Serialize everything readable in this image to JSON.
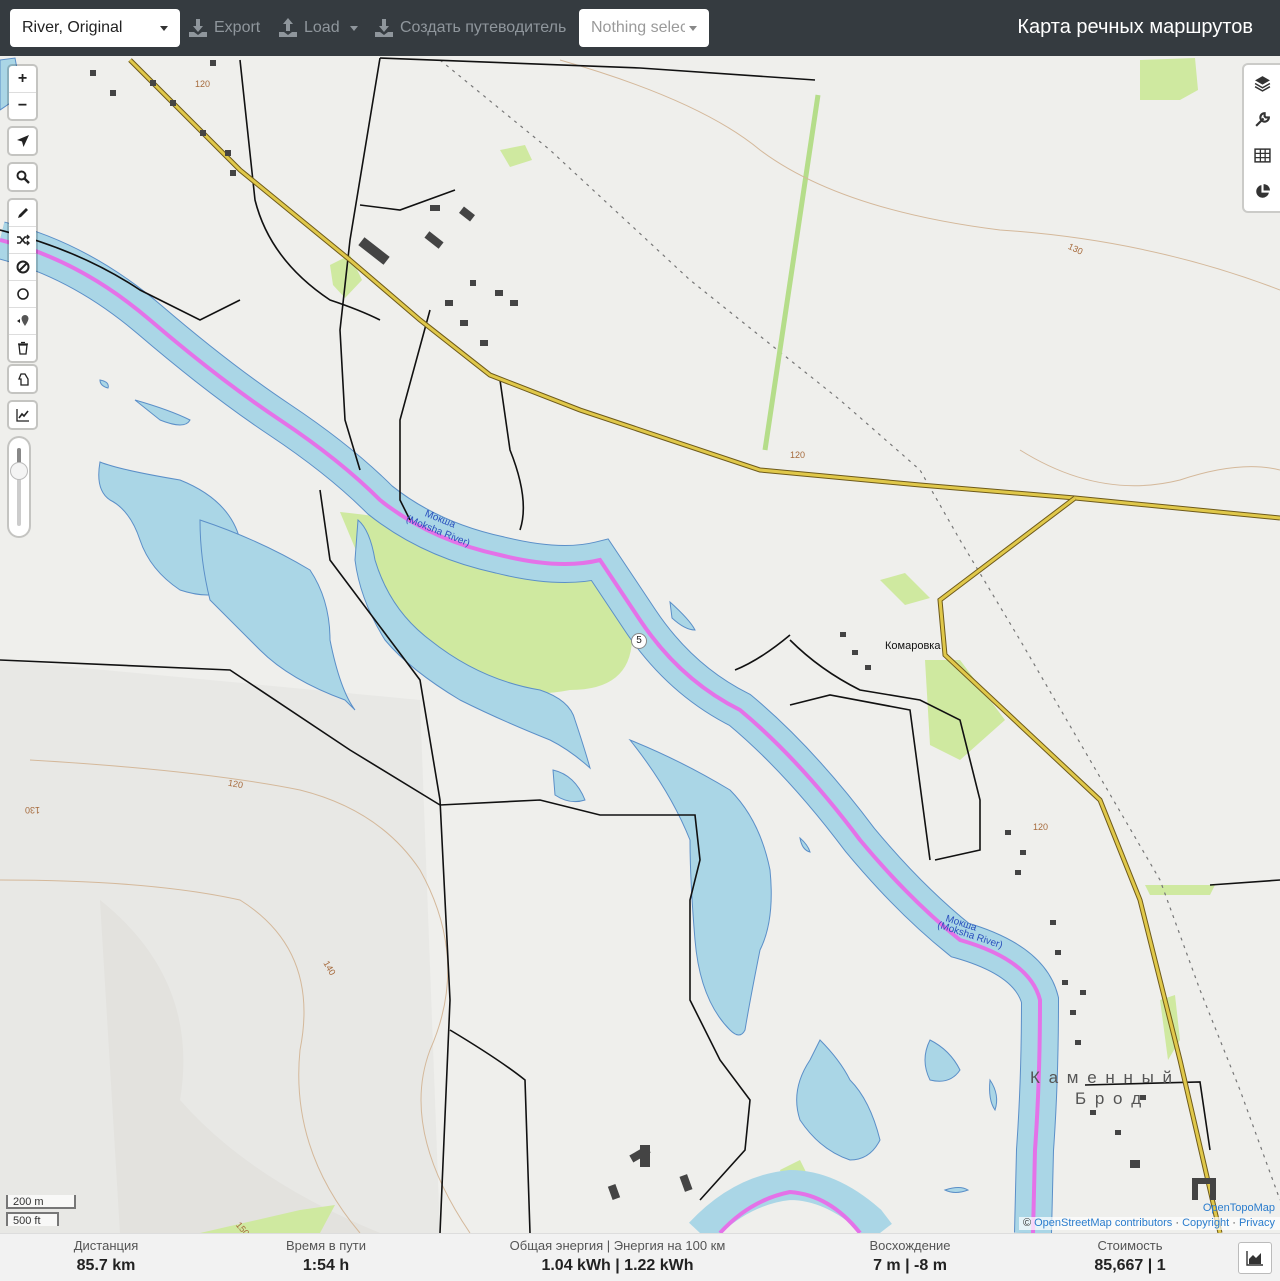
{
  "header": {
    "profile": "River, Original",
    "export_label": "Export",
    "load_label": "Load",
    "guide_label": "Создать путеводитель",
    "selection_placeholder": "Nothing selected",
    "app_title": "Карта речных маршрутов"
  },
  "map_controls": {
    "zoom_in": "+",
    "zoom_out": "−"
  },
  "map_labels": {
    "river_ru_1": "Мокша",
    "river_en_1": "(Moksha River)",
    "river_ru_2": "Мокша",
    "river_en_2": "(Moksha River)",
    "village_1": "Комаровка",
    "village_2_line1": "К а м е н н ы й",
    "village_2_line2": "Б р о д",
    "route_marker": "5",
    "contour_1": "120",
    "contour_2": "120",
    "contour_3": "130",
    "contour_4": "120",
    "contour_5": "120",
    "contour_6": "130",
    "contour_7": "140",
    "contour_8": "150"
  },
  "scale": {
    "metric": "200 m",
    "imperial": "500 ft"
  },
  "attribution": {
    "provider": "OpenTopoMap",
    "prefix": "©",
    "osm": "OpenStreetMap contributors",
    "copyright": "Copyright",
    "privacy": "Privacy"
  },
  "stats": {
    "distance": {
      "label": "Дистанция",
      "value": "85.7 km"
    },
    "time": {
      "label": "Время в пути",
      "value": "1:54 h"
    },
    "energy": {
      "label": "Общая энергия | Энергия на 100 км",
      "value": "1.04 kWh | 1.22 kWh"
    },
    "ascent": {
      "label": "Восхождение",
      "value": "7 m | -8 m"
    },
    "cost": {
      "label": "Стоимость",
      "value": "85,667 | 1"
    }
  },
  "colors": {
    "water": "#aad6e6",
    "route": "#e472e8",
    "forest": "#cfe9a0",
    "major_road": "#e0c84a",
    "toolbar": "#353b40"
  }
}
